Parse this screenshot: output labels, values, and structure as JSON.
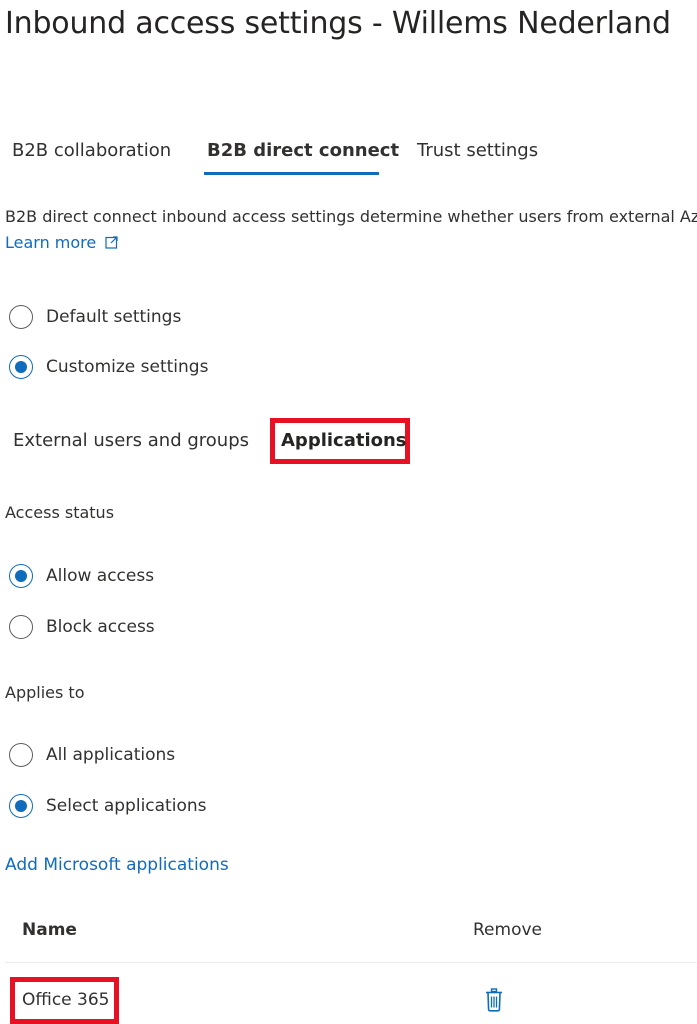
{
  "header": {
    "title": "Inbound access settings - Willems Nederland"
  },
  "tabs": [
    {
      "label": "B2B collaboration",
      "active": false
    },
    {
      "label": "B2B direct connect",
      "active": true
    },
    {
      "label": "Trust settings",
      "active": false
    }
  ],
  "description": {
    "text": "B2B direct connect inbound access settings determine whether users from external Az",
    "learn_more": "Learn more",
    "learn_more_icon": "external-link-icon"
  },
  "settings_mode": {
    "options": [
      {
        "label": "Default settings",
        "checked": false
      },
      {
        "label": "Customize settings",
        "checked": true
      }
    ]
  },
  "subtabs": [
    {
      "label": "External users and groups",
      "active": false
    },
    {
      "label": "Applications",
      "active": true,
      "highlighted": true
    }
  ],
  "access_status": {
    "label": "Access status",
    "options": [
      {
        "label": "Allow access",
        "checked": true
      },
      {
        "label": "Block access",
        "checked": false
      }
    ]
  },
  "applies_to": {
    "label": "Applies to",
    "options": [
      {
        "label": "All applications",
        "checked": false
      },
      {
        "label": "Select applications",
        "checked": true
      }
    ]
  },
  "add_link": "Add Microsoft applications",
  "table": {
    "columns": [
      "Name",
      "Remove"
    ],
    "rows": [
      {
        "name": "Office 365",
        "highlighted": true,
        "remove_icon": "trash-icon"
      }
    ]
  },
  "colors": {
    "accent": "#0f6cbd",
    "highlight": "#e81123",
    "text": "#323130"
  }
}
